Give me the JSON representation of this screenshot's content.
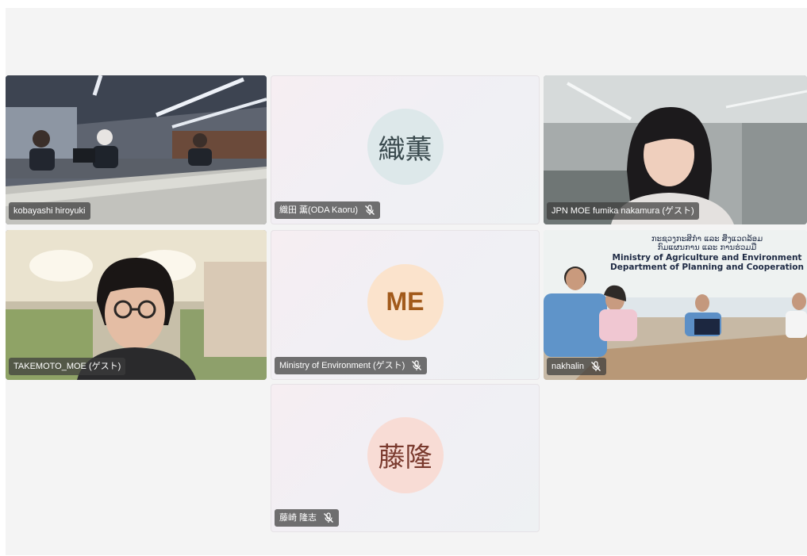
{
  "participants": [
    {
      "id": "kobayashi",
      "name": "kobayashi hiroyuki",
      "muted": false,
      "type": "video"
    },
    {
      "id": "oda",
      "name": "織田 薫(ODA Kaoru)",
      "muted": true,
      "type": "avatar",
      "initials": "織薫",
      "avatar_bg": "#dde8ea",
      "avatar_fg": "#3a4a4e"
    },
    {
      "id": "nakamura",
      "name": "JPN MOE fumika nakamura (ゲスト)",
      "muted": false,
      "type": "video"
    },
    {
      "id": "takemoto",
      "name": "TAKEMOTO_MOE (ゲスト)",
      "muted": false,
      "type": "video",
      "active": true
    },
    {
      "id": "moe",
      "name": "Ministry of Environment (ゲスト)",
      "muted": true,
      "type": "avatar",
      "initials": "ME",
      "avatar_bg": "#fbe3cc",
      "avatar_fg": "#a25a1b"
    },
    {
      "id": "nakhalin",
      "name": "nakhalin",
      "muted": true,
      "type": "video"
    },
    {
      "id": "fujisaki",
      "name": "藤崎 隆志",
      "muted": true,
      "type": "avatar",
      "initials": "藤隆",
      "avatar_bg": "#f8dcd5",
      "avatar_fg": "#7a3a2e"
    }
  ],
  "banner": {
    "line1": "ກະຊວງກະສິກຳ ແລະ ສິ່ງແວດລ້ອມ",
    "line2": "ກົມແຜນການ ແລະ ການຮ່ວມມື",
    "line3": "Ministry of Agriculture and Environment",
    "line4": "Department of Planning and Cooperation"
  },
  "colors": {
    "active_speaker": "#5b5fc7",
    "name_tag_bg": "#3c3c3c"
  }
}
